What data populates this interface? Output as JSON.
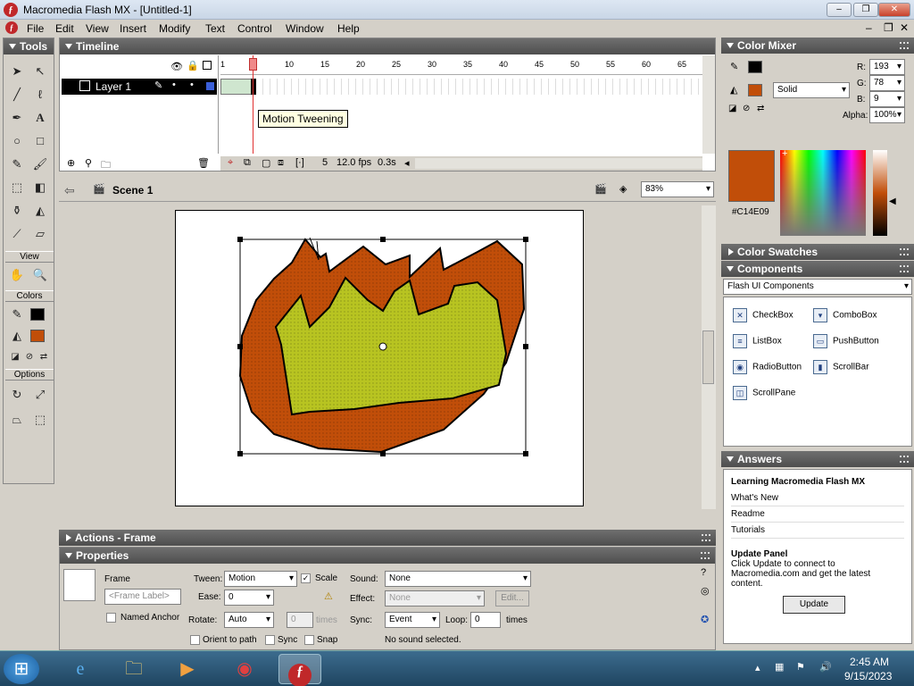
{
  "window": {
    "title": "Macromedia Flash MX - [Untitled-1]",
    "app_icon": "flash-icon"
  },
  "menu": [
    "File",
    "Edit",
    "View",
    "Insert",
    "Modify",
    "Text",
    "Control",
    "Window",
    "Help"
  ],
  "tools": {
    "title": "Tools",
    "view_label": "View",
    "colors_label": "Colors",
    "options_label": "Options",
    "stroke_color": "#000000",
    "fill_color": "#C14E09"
  },
  "timeline": {
    "title": "Timeline",
    "layer_name": "Layer 1",
    "ruler": [
      "1",
      "5",
      "10",
      "15",
      "20",
      "25",
      "30",
      "35",
      "40",
      "45",
      "50",
      "55",
      "60",
      "65"
    ],
    "current_frame": "5",
    "fps": "12.0 fps",
    "time": "0.3s",
    "tooltip": "Motion Tweening"
  },
  "stage": {
    "scene": "Scene 1",
    "zoom": "83%"
  },
  "actions": {
    "title": "Actions - Frame"
  },
  "properties": {
    "title": "Properties",
    "frame_label": "Frame",
    "frame_placeholder": "<Frame Label>",
    "named_anchor": "Named Anchor",
    "tween_label": "Tween:",
    "tween_value": "Motion",
    "scale_label": "Scale",
    "ease_label": "Ease:",
    "ease_value": "0",
    "rotate_label": "Rotate:",
    "rotate_value": "Auto",
    "rotate_times_value": "0",
    "times_label": "times",
    "orient_label": "Orient to path",
    "sync_label": "Sync",
    "snap_label": "Snap",
    "sound_label": "Sound:",
    "sound_value": "None",
    "effect_label": "Effect:",
    "effect_value": "None",
    "edit_label": "Edit...",
    "sync_sound_label": "Sync:",
    "sync_sound_value": "Event",
    "loop_label": "Loop:",
    "loop_value": "0",
    "loop_times": "times",
    "no_sound": "No sound selected."
  },
  "color_mixer": {
    "title": "Color Mixer",
    "r_label": "R:",
    "r_value": "193",
    "g_label": "G:",
    "g_value": "78",
    "b_label": "B:",
    "b_value": "9",
    "fill_type": "Solid",
    "alpha_label": "Alpha:",
    "alpha_value": "100%",
    "hex": "#C14E09",
    "swatch_color": "#C14E09"
  },
  "color_swatches": {
    "title": "Color Swatches"
  },
  "components": {
    "title": "Components",
    "set": "Flash UI Components",
    "items": [
      "CheckBox",
      "ComboBox",
      "ListBox",
      "PushButton",
      "RadioButton",
      "ScrollBar",
      "ScrollPane"
    ]
  },
  "answers": {
    "title": "Answers",
    "heading": "Learning Macromedia Flash MX",
    "links": [
      "What's New",
      "Readme",
      "Tutorials"
    ],
    "update_heading": "Update Panel",
    "update_text": "Click Update to connect to Macromedia.com and get the latest content.",
    "update_button": "Update"
  },
  "taskbar": {
    "time": "2:45 AM",
    "date": "9/15/2023"
  }
}
